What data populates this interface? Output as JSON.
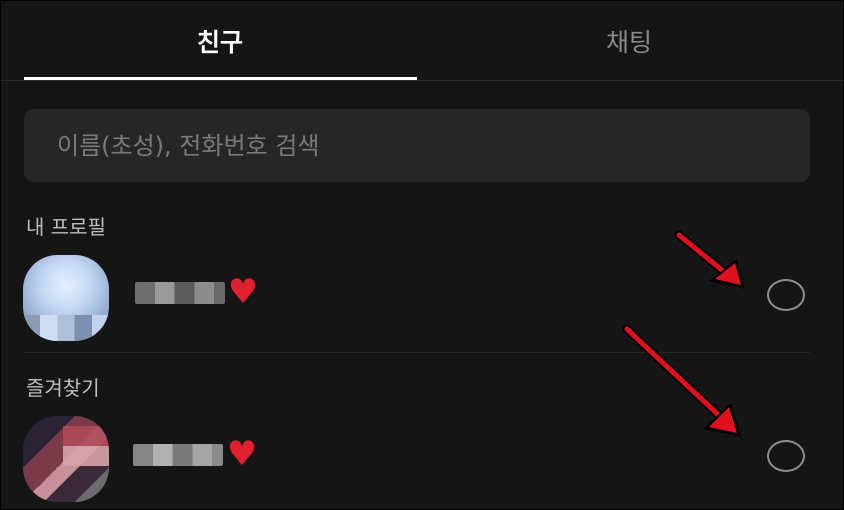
{
  "tabs": [
    {
      "label": "친구",
      "active": true
    },
    {
      "label": "채팅",
      "active": false
    }
  ],
  "search": {
    "placeholder": "이름(초성), 전화번호 검색",
    "value": ""
  },
  "sections": {
    "my_profile": {
      "title": "내 프로필"
    },
    "favorites": {
      "title": "즐겨찾기"
    }
  },
  "colors": {
    "background": "#151515",
    "search_bg": "#262626",
    "active_tab": "#ffffff",
    "inactive_tab": "#8a8a8a",
    "annotation_arrow": "#e0101e",
    "heart": "#e0202e"
  },
  "icons": {
    "heart": "heart-icon",
    "radio": "radio-button-unchecked",
    "annotation": "red-arrow-pointer"
  }
}
